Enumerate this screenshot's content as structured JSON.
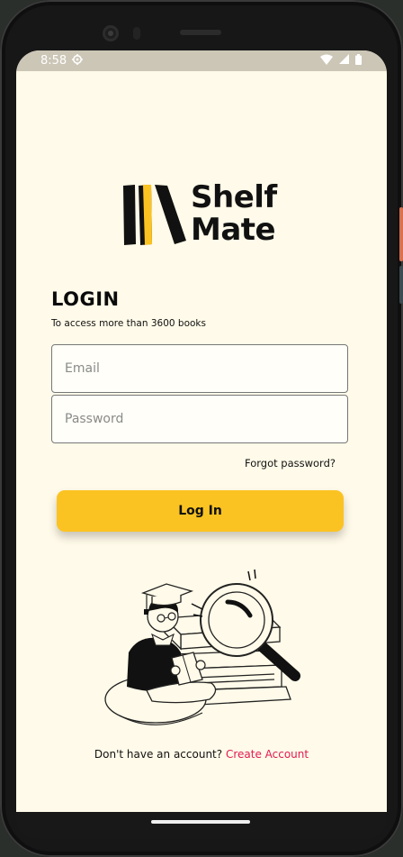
{
  "status_bar": {
    "time": "8:58"
  },
  "brand": {
    "line1": "Shelf",
    "line2": "Mate"
  },
  "login": {
    "title": "LOGIN",
    "subtitle": "To access more than 3600 books",
    "email_placeholder": "Email",
    "password_placeholder": "Password",
    "forgot_label": "Forgot password?",
    "button_label": "Log In"
  },
  "footer": {
    "prompt": "Don't have an account?",
    "link_label": "Create Account"
  },
  "colors": {
    "background": "#fffae9",
    "accent": "#fbc322",
    "link": "#e21a53",
    "status_bar": "#ccc6b7"
  }
}
